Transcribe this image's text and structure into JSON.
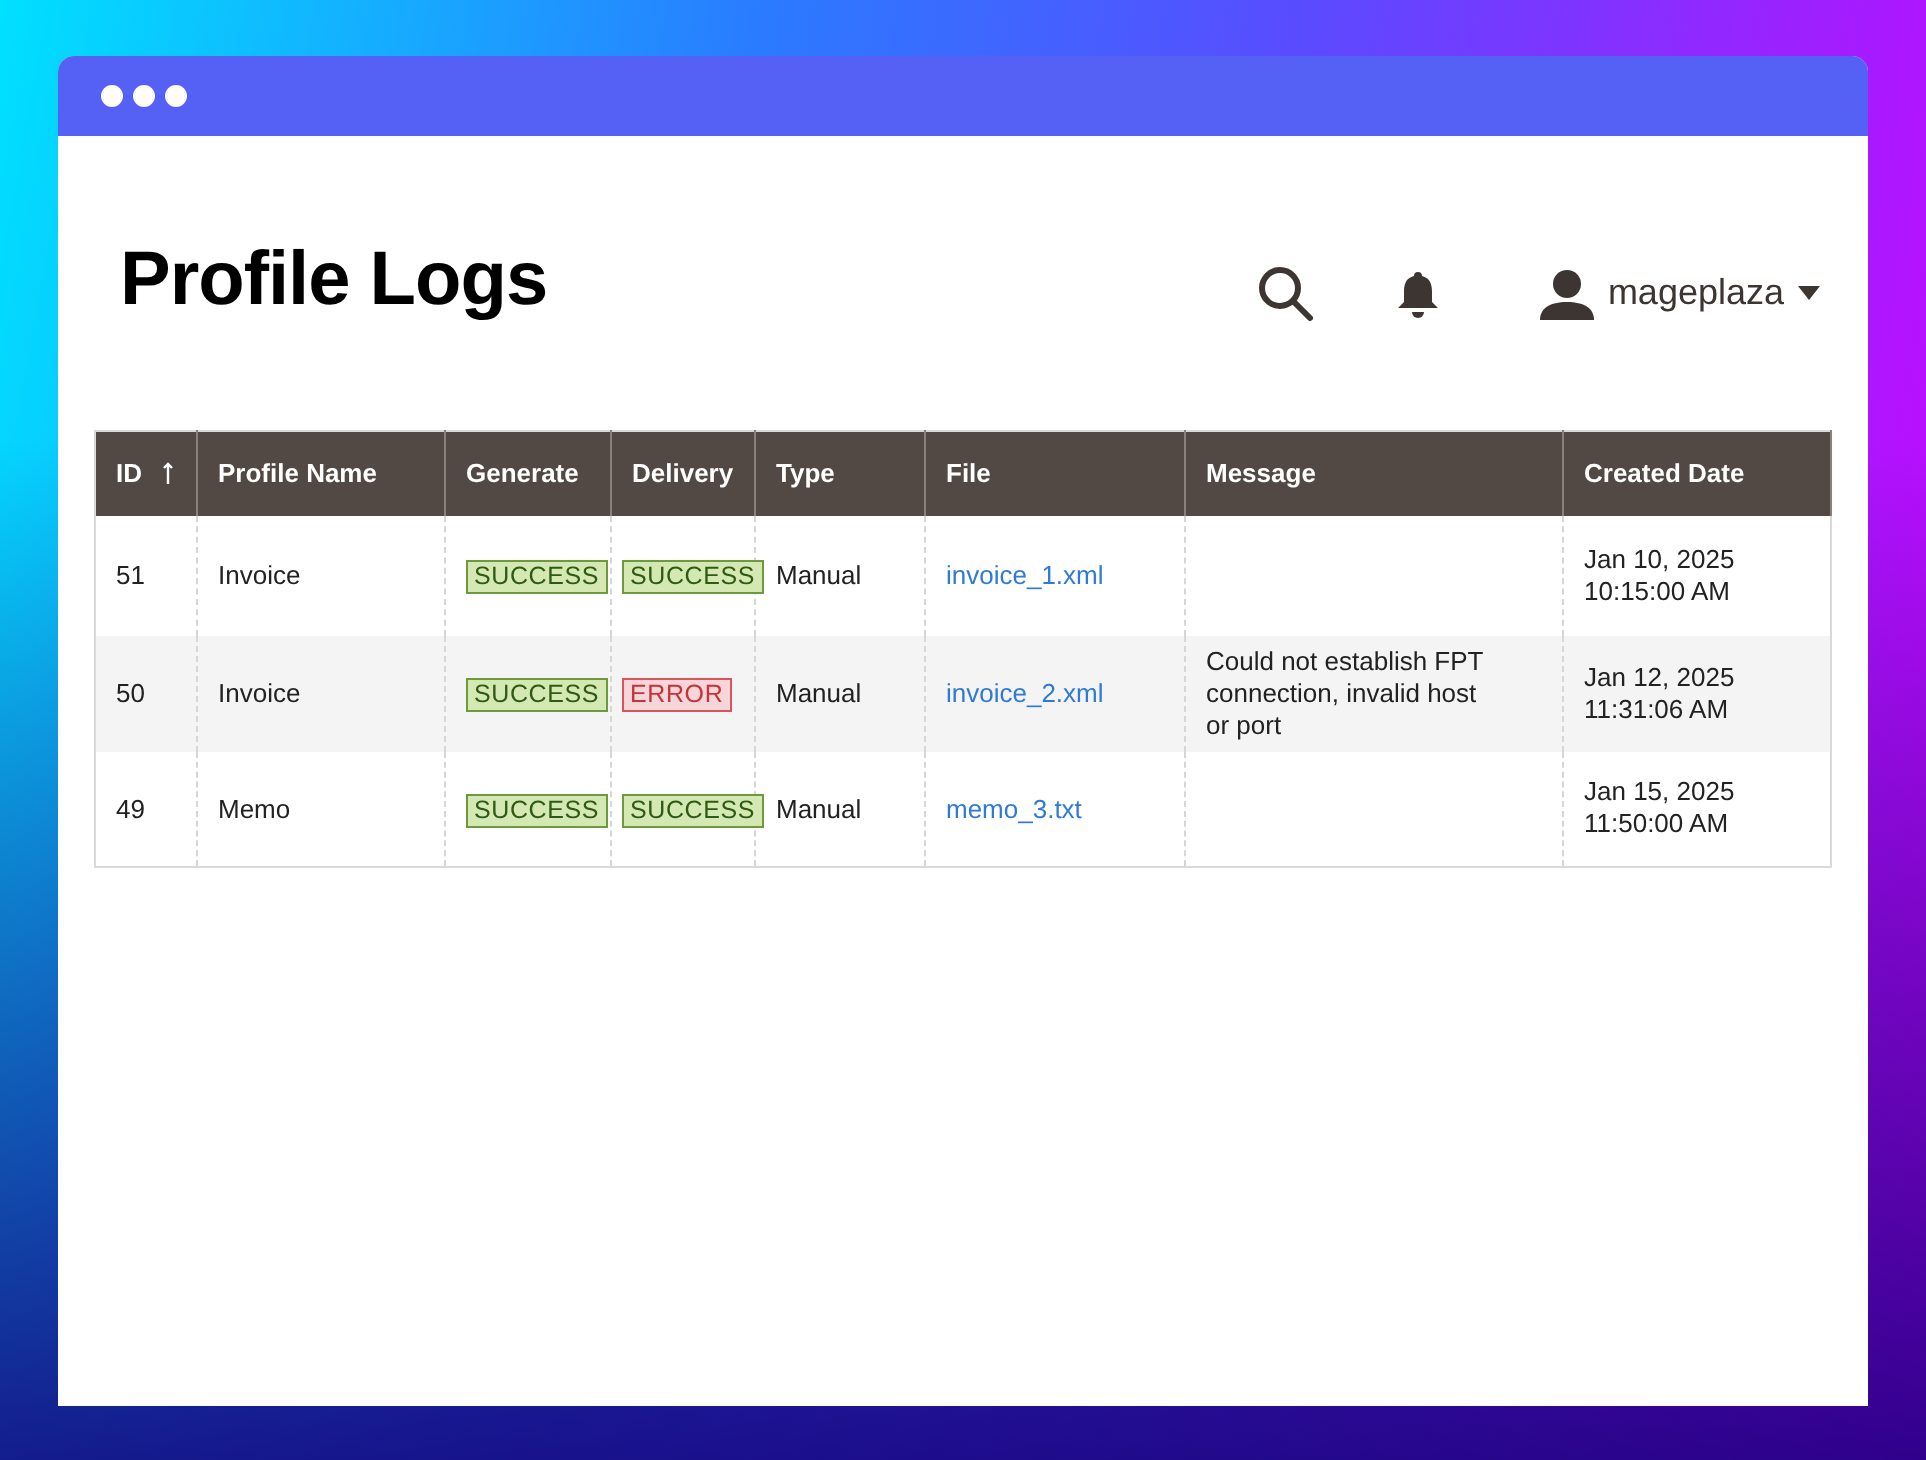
{
  "page": {
    "title": "Profile Logs"
  },
  "user": {
    "name": "mageplaza"
  },
  "table": {
    "columns": [
      {
        "label": "ID",
        "sorted": true
      },
      {
        "label": "Profile Name",
        "sorted": false
      },
      {
        "label": "Generate",
        "sorted": false
      },
      {
        "label": "Delivery",
        "sorted": false
      },
      {
        "label": "Type",
        "sorted": false
      },
      {
        "label": "File",
        "sorted": false
      },
      {
        "label": "Message",
        "sorted": false
      },
      {
        "label": "Created Date",
        "sorted": false
      }
    ],
    "rows": [
      {
        "id": "51",
        "profile_name": "Invoice",
        "generate": {
          "kind": "success",
          "label": "SUCCESS"
        },
        "delivery": {
          "kind": "success",
          "label": "SUCCESS"
        },
        "type": "Manual",
        "file": "invoice_1.xml",
        "date": "Jan 10, 2025",
        "time": "10:15:00 AM"
      },
      {
        "id": "50",
        "profile_name": "Invoice",
        "generate": {
          "kind": "success",
          "label": "SUCCESS"
        },
        "delivery": {
          "kind": "error",
          "label": "ERROR"
        },
        "type": "Manual",
        "file": "invoice_2.xml",
        "message": "Could not establish FPT connection, invalid host or port",
        "date": "Jan 12, 2025",
        "time": "11:31:06 AM"
      },
      {
        "id": "49",
        "profile_name": "Memo",
        "generate": {
          "kind": "success",
          "label": "SUCCESS"
        },
        "delivery": {
          "kind": "success",
          "label": "SUCCESS"
        },
        "type": "Manual",
        "file": "memo_3.txt",
        "date": "Jan 15, 2025",
        "time": "11:50:00 AM"
      }
    ]
  }
}
